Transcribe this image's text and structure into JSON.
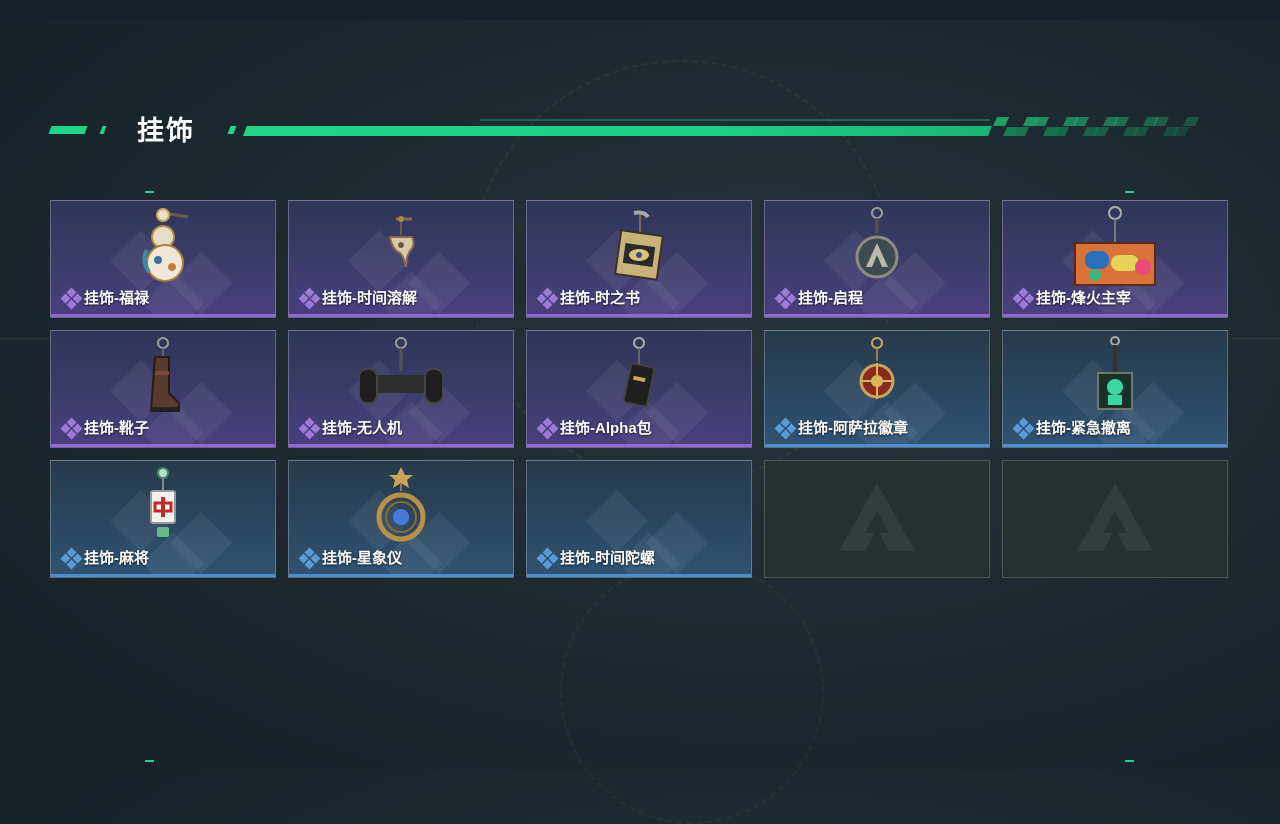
{
  "section": {
    "title": "挂饰"
  },
  "colors": {
    "accent": "#22d48a",
    "purple_rarity": "#9267d8",
    "blue_rarity": "#4b8fd0"
  },
  "items": [
    {
      "label": "挂饰-福禄",
      "rarity": "purple",
      "icon": "gourd-charm-icon"
    },
    {
      "label": "挂饰-时间溶解",
      "rarity": "purple",
      "icon": "melting-clock-charm-icon"
    },
    {
      "label": "挂饰-时之书",
      "rarity": "purple",
      "icon": "eye-book-charm-icon"
    },
    {
      "label": "挂饰-启程",
      "rarity": "purple",
      "icon": "badge-charm-icon"
    },
    {
      "label": "挂饰-烽火主宰",
      "rarity": "purple",
      "icon": "container-charm-icon"
    },
    {
      "label": "挂饰-靴子",
      "rarity": "purple",
      "icon": "boot-charm-icon"
    },
    {
      "label": "挂饰-无人机",
      "rarity": "purple",
      "icon": "drone-charm-icon"
    },
    {
      "label": "挂饰-Alpha包",
      "rarity": "purple",
      "icon": "bag-charm-icon"
    },
    {
      "label": "挂饰-阿萨拉徽章",
      "rarity": "blue",
      "icon": "emblem-charm-icon"
    },
    {
      "label": "挂饰-紧急撤离",
      "rarity": "blue",
      "icon": "evac-sign-charm-icon"
    },
    {
      "label": "挂饰-麻将",
      "rarity": "blue",
      "icon": "mahjong-charm-icon"
    },
    {
      "label": "挂饰-星象仪",
      "rarity": "blue",
      "icon": "astrolabe-charm-icon"
    },
    {
      "label": "挂饰-时间陀螺",
      "rarity": "blue",
      "icon": ""
    },
    {
      "label": "",
      "rarity": "empty",
      "icon": "empty-slot-logo-icon"
    },
    {
      "label": "",
      "rarity": "empty",
      "icon": "empty-slot-logo-icon"
    }
  ]
}
